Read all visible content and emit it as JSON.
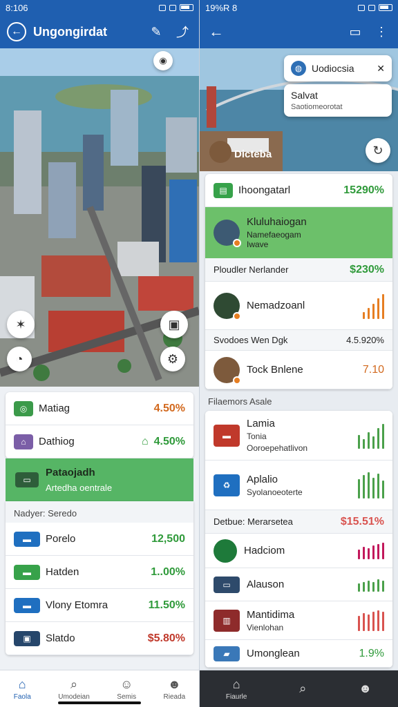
{
  "left": {
    "status": {
      "time": "8:106",
      "icons": [
        "signal-icon",
        "wifi-icon",
        "battery-icon"
      ]
    },
    "appbar": {
      "title": "Ungongirdat"
    },
    "list_top": [
      {
        "label": "Matiag",
        "value": "4.50%",
        "color": "orange"
      },
      {
        "label": "Dathiog",
        "value": "4.50%",
        "color": "green"
      }
    ],
    "highlight": {
      "title": "Pataojadh",
      "subtitle": "Artedha oentrale"
    },
    "section_label": "Nadyer: Seredo",
    "list_bottom": [
      {
        "label": "Porelo",
        "value": "12,500",
        "color": "green"
      },
      {
        "label": "Hatden",
        "value": "1..00%",
        "color": "green"
      },
      {
        "label": "Vlony Etomra",
        "value": "11.50%",
        "color": "green"
      },
      {
        "label": "Slatdo",
        "value": "$5.80%",
        "color": "red"
      }
    ],
    "nav": [
      {
        "label": "Faola",
        "icon": "home-icon",
        "active": true
      },
      {
        "label": "Umodeian",
        "icon": "search-icon",
        "active": false
      },
      {
        "label": "Semis",
        "icon": "group-icon",
        "active": false
      },
      {
        "label": "Rieada",
        "icon": "person-icon",
        "active": false
      }
    ]
  },
  "right": {
    "status": {
      "time": "19%R 8"
    },
    "popup1": {
      "text": "Uodiocsia"
    },
    "popup2": {
      "title": "Salvat",
      "subtitle": "Saotiomeorotat"
    },
    "hero_label": "Dicteba",
    "top_card": [
      {
        "label": "Ihoongatarl",
        "value": "15290%",
        "color": "green"
      },
      {
        "label": "Kluluhaiogan",
        "sub1": "Namefaeogam",
        "sub2": "Iwave",
        "highlight": true
      }
    ],
    "row_plain1": {
      "label": "Ploudler Nerlander",
      "value": "$230%"
    },
    "row_chart1": {
      "label": "Nemadzoanl"
    },
    "row_plain2": {
      "label": "Svodoes Wen Dgk",
      "value": "4.5.920%"
    },
    "row_val": {
      "label": "Tock Bnlene",
      "value": "7.10"
    },
    "section_label": "Filaemors Asale",
    "list": [
      {
        "title": "Lamia",
        "sub1": "Tonia",
        "sub2": "Ooroepehatlivon",
        "bar_color": "#4aa04a"
      },
      {
        "title": "Aplalio",
        "sub1": "Syolanoeoterte",
        "bar_color": "#4aa04a"
      },
      {
        "label": "Detbue: Merarsetea",
        "value": "$15.51%"
      },
      {
        "title": "Hadciom",
        "bar_color": "#c2185b"
      },
      {
        "title": "Alauson",
        "bar_color": "#4aa04a"
      },
      {
        "title": "Mantidima",
        "sub1": "Vienlohan",
        "bar_color": "#d9534f"
      },
      {
        "title": "Umonglean",
        "value": "1.9%"
      }
    ],
    "nav": [
      {
        "label": "Fiaurle",
        "icon": "home-icon",
        "active": true
      },
      {
        "label": "",
        "icon": "search-icon",
        "active": false
      },
      {
        "label": "",
        "icon": "person-icon",
        "active": false
      }
    ]
  }
}
